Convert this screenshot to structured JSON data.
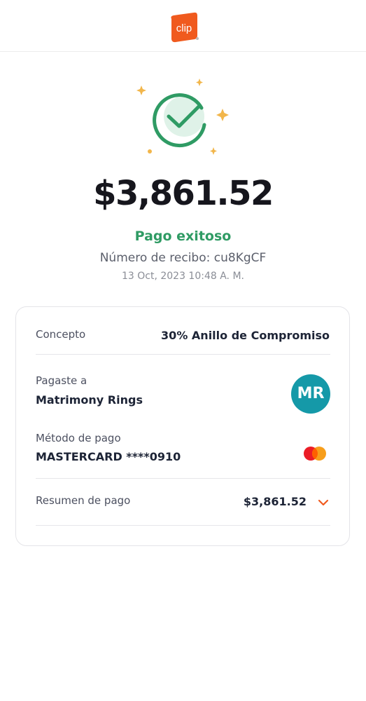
{
  "header": {
    "logo_text": "clip"
  },
  "payment": {
    "amount": "$3,861.52",
    "status": "Pago exitoso",
    "receipt": "Número de recibo: cu8KgCF",
    "datetime": "13 Oct, 2023 10:48 A. M."
  },
  "details": {
    "concept_label": "Concepto",
    "concept_value": "30% Anillo de Compromiso",
    "paid_to_label": "Pagaste a",
    "paid_to_value": "Matrimony Rings",
    "avatar_initials": "MR",
    "method_label": "Método de pago",
    "method_value": "MASTERCARD ****0910",
    "summary_label": "Resumen de pago",
    "summary_amount": "$3,861.52"
  },
  "colors": {
    "brand_orange": "#f05a1e",
    "success_green": "#2f9b64",
    "avatar_teal": "#1599a8",
    "sparkle": "#f2b64b"
  },
  "icons": {
    "logo": "clip-logo",
    "success": "check-circle-icon",
    "card": "mastercard-icon",
    "expand": "chevron-down-icon"
  }
}
